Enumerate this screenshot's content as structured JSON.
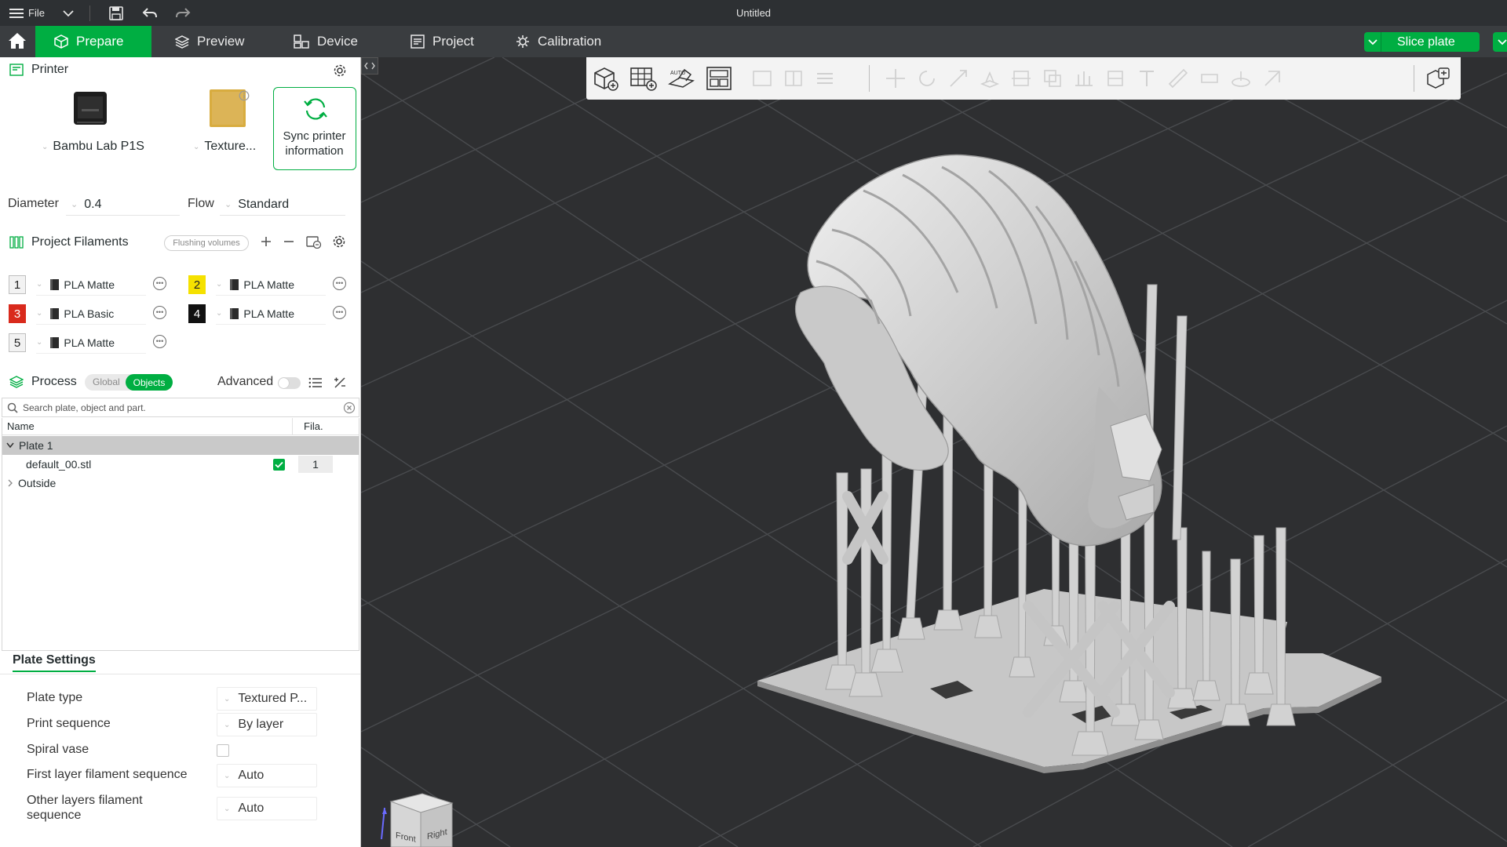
{
  "titlebar": {
    "file_label": "File",
    "title": "Untitled"
  },
  "nav": {
    "tabs": [
      {
        "label": "Prepare",
        "icon": "cube-icon",
        "active": true
      },
      {
        "label": "Preview",
        "icon": "layers-icon",
        "active": false
      },
      {
        "label": "Device",
        "icon": "device-icon",
        "active": false
      },
      {
        "label": "Project",
        "icon": "project-icon",
        "active": false
      },
      {
        "label": "Calibration",
        "icon": "calibration-icon",
        "active": false
      }
    ],
    "slice_label": "Slice plate"
  },
  "printer": {
    "section_title": "Printer",
    "printer_name": "Bambu Lab P1S",
    "plate_name": "Texture...",
    "sync_label_line1": "Sync printer",
    "sync_label_line2": "information",
    "diameter_label": "Diameter",
    "diameter_value": "0.4",
    "flow_label": "Flow",
    "flow_value": "Standard"
  },
  "filaments": {
    "section_title": "Project Filaments",
    "flushing_label": "Flushing volumes",
    "items": [
      {
        "num": "1",
        "name": "PLA Matte",
        "color": "#f2f2f2",
        "text_color": "#222222"
      },
      {
        "num": "2",
        "name": "PLA Matte",
        "color": "#f5e100",
        "text_color": "#222222"
      },
      {
        "num": "3",
        "name": "PLA Basic",
        "color": "#d92a1c",
        "text_color": "#ffffff"
      },
      {
        "num": "4",
        "name": "PLA Matte",
        "color": "#111111",
        "text_color": "#ffffff"
      },
      {
        "num": "5",
        "name": "PLA Matte",
        "color": "#f2f2f2",
        "text_color": "#222222"
      }
    ]
  },
  "process": {
    "section_title": "Process",
    "global_label": "Global",
    "objects_label": "Objects",
    "advanced_label": "Advanced",
    "search_placeholder": "Search plate, object and part."
  },
  "object_list": {
    "col_name": "Name",
    "col_fila": "Fila.",
    "plate_label": "Plate 1",
    "object_name": "default_00.stl",
    "object_fila": "1",
    "outside_label": "Outside"
  },
  "plate_settings": {
    "tab_label": "Plate Settings",
    "rows": [
      {
        "label": "Plate type",
        "value": "Textured P..."
      },
      {
        "label": "Print sequence",
        "value": "By layer"
      },
      {
        "label": "Spiral vase",
        "value": ""
      },
      {
        "label": "First layer filament sequence",
        "value": "Auto"
      },
      {
        "label": "Other layers filament sequence",
        "value": "Auto"
      }
    ]
  },
  "viewcube": {
    "front_label": "Front",
    "right_label": "Right"
  },
  "colors": {
    "accent": "#00ae42",
    "viewport_bg": "#2e2f31",
    "grid": "#47494c",
    "model": "#d9d9d9"
  }
}
